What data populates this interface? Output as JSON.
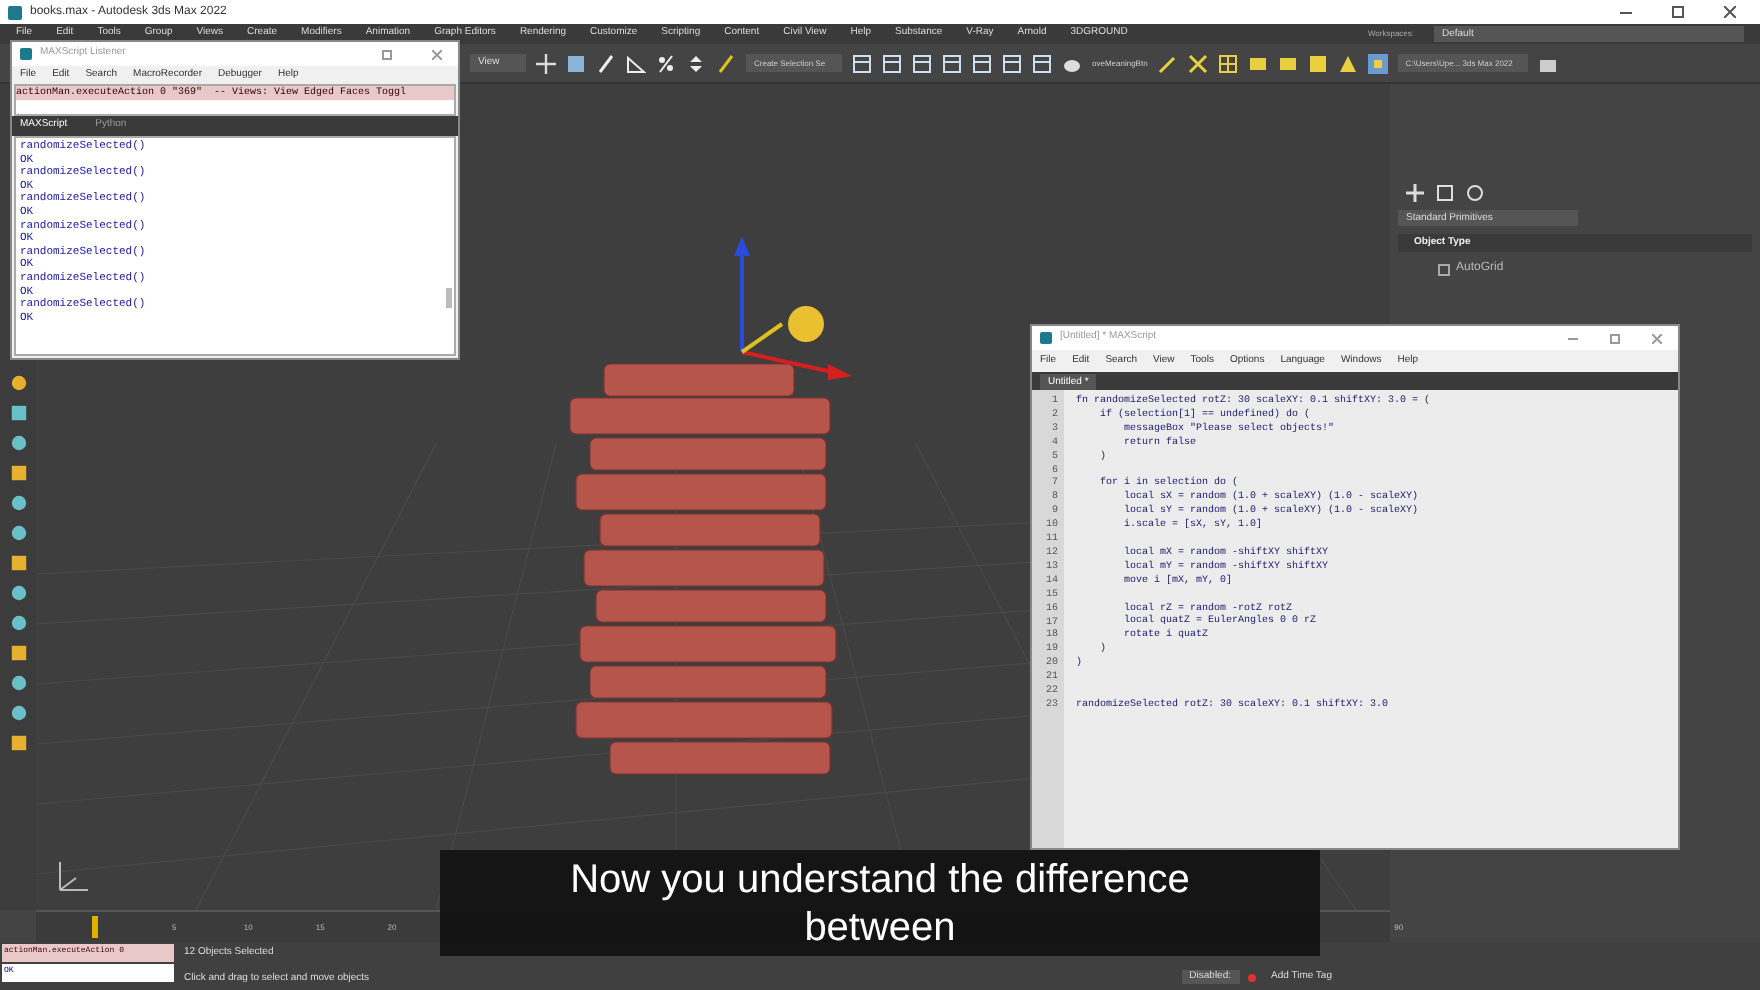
{
  "window": {
    "title": "books.max - Autodesk 3ds Max 2022"
  },
  "menu": [
    "File",
    "Edit",
    "Tools",
    "Group",
    "Views",
    "Create",
    "Modifiers",
    "Animation",
    "Graph Editors",
    "Rendering",
    "Customize",
    "Scripting",
    "Content",
    "Civil View",
    "Help",
    "Substance",
    "V-Ray",
    "Arnold",
    "3DGROUND"
  ],
  "workspaces": {
    "label": "Workspaces:",
    "value": "Default"
  },
  "toolbar": {
    "view_dropdown": "View",
    "selection_set": "Create Selection Se",
    "script_button": "oveMeaningBtn",
    "project_path": "C:\\Users\\Upe... 3ds Max 2022"
  },
  "command_panel": {
    "category": "Standard Primitives",
    "rollout": "Object Type",
    "autogrid": {
      "label": "AutoGrid",
      "checked": false
    }
  },
  "listener": {
    "title": "MAXScript Listener",
    "menu": [
      "File",
      "Edit",
      "Search",
      "MacroRecorder",
      "Debugger",
      "Help"
    ],
    "macro_line": "actionMan.executeAction 0 \"369\"  -- Views: View Edged Faces Toggl",
    "tabs": [
      {
        "label": "MAXScript",
        "selected": true
      },
      {
        "label": "Python",
        "selected": false
      }
    ],
    "output": [
      "randomizeSelected()",
      "OK",
      "randomizeSelected()",
      "OK",
      "randomizeSelected()",
      "OK",
      "randomizeSelected()",
      "OK",
      "randomizeSelected()",
      "OK",
      "randomizeSelected()",
      "OK",
      "randomizeSelected()",
      "OK"
    ]
  },
  "editor": {
    "title": "[Untitled] * MAXScript",
    "menu": [
      "File",
      "Edit",
      "Search",
      "View",
      "Tools",
      "Options",
      "Language",
      "Windows",
      "Help"
    ],
    "tab": "Untitled *",
    "lines": [
      {
        "number": "1",
        "code": "fn randomizeSelected rotZ: 30 scaleXY: 0.1 shiftXY: 3.0 = ("
      },
      {
        "number": "2",
        "code": "    if (selection[1] == undefined) do ("
      },
      {
        "number": "3",
        "code": "        messageBox \"Please select objects!\""
      },
      {
        "number": "4",
        "code": "        return false"
      },
      {
        "number": "5",
        "code": "    )"
      },
      {
        "number": "6"
      },
      {
        "number": "7",
        "code": "    for i in selection do ("
      },
      {
        "number": "8",
        "code": "        local sX = random (1.0 + scaleXY) (1.0 - scaleXY)"
      },
      {
        "number": "9",
        "code": "        local sY = random (1.0 + scaleXY) (1.0 - scaleXY)"
      },
      {
        "number": "10",
        "code": "        i.scale = [sX, sY, 1.0]"
      },
      {
        "number": "11"
      },
      {
        "number": "12",
        "code": "        local mX = random -shiftXY shiftXY"
      },
      {
        "number": "13",
        "code": "        local mY = random -shiftXY shiftXY"
      },
      {
        "number": "14",
        "code": "        move i [mX, mY, 0]"
      },
      {
        "number": "15"
      },
      {
        "number": "16",
        "code": "        local rZ = random -rotZ rotZ"
      },
      {
        "number": "17",
        "code": "        local quatZ = EulerAngles 0 0 rZ"
      },
      {
        "number": "18",
        "code": "        rotate i quatZ"
      },
      {
        "number": "19",
        "code": "    )"
      },
      {
        "number": "20",
        "code": ")"
      },
      {
        "number": "21"
      },
      {
        "number": "22"
      },
      {
        "number": "23",
        "code": "randomizeSelected rotZ: 30 scaleXY: 0.1 shiftXY: 3.0"
      }
    ]
  },
  "subtitle": "Now you understand the difference between",
  "timeline": {
    "ticks": [
      "5",
      "10",
      "15",
      "20",
      "90"
    ]
  },
  "status_bar": {
    "mini_listener": "actionMan.executeAction 0",
    "mini_result": "OK",
    "selection": "12 Objects Selected",
    "prompt": "Click and drag to select and move objects",
    "disabled_label": "Disabled:",
    "time_tag": "Add Time Tag"
  }
}
